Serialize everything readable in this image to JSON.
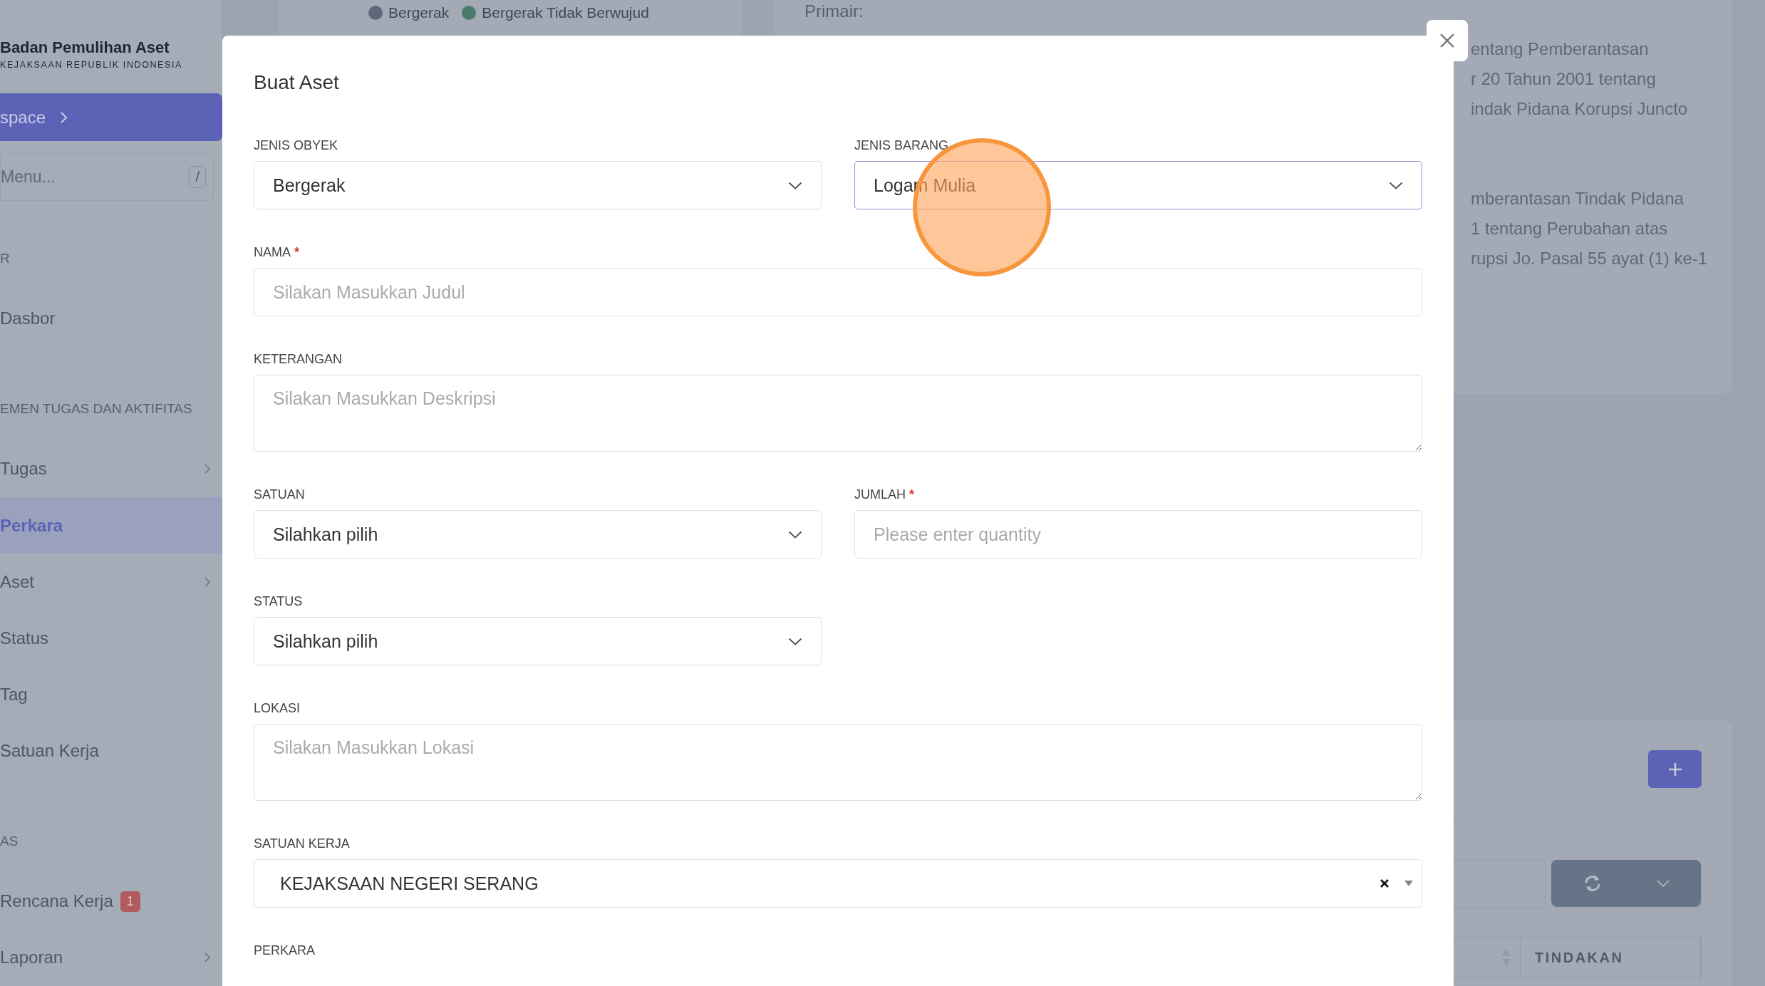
{
  "sidebar": {
    "brand_title": "Badan Pemulihan Aset",
    "brand_subtitle": "KEJAKSAAN REPUBLIK INDONESIA",
    "workspace_button": "space",
    "search": {
      "placeholder": "Menu...",
      "shortcut": "/"
    },
    "items": [
      {
        "kind": "section",
        "label": "R"
      },
      {
        "kind": "link",
        "label": "Dasbor",
        "chevron": false,
        "selected": false
      },
      {
        "kind": "section",
        "label": "EMEN TUGAS DAN AKTIFITAS"
      },
      {
        "kind": "link",
        "label": "Tugas",
        "chevron": true,
        "selected": false
      },
      {
        "kind": "link",
        "label": "Perkara",
        "chevron": false,
        "selected": true
      },
      {
        "kind": "link",
        "label": "Aset",
        "chevron": true,
        "selected": false
      },
      {
        "kind": "link",
        "label": "Status",
        "chevron": false,
        "selected": false
      },
      {
        "kind": "link",
        "label": "Tag",
        "chevron": false,
        "selected": false
      },
      {
        "kind": "link",
        "label": "Satuan Kerja",
        "chevron": false,
        "selected": false
      },
      {
        "kind": "section",
        "label": "AS"
      },
      {
        "kind": "link",
        "label": "Rencana Kerja",
        "chevron": false,
        "selected": false,
        "badge": "1"
      },
      {
        "kind": "link",
        "label": "Laporan",
        "chevron": true,
        "selected": false
      }
    ]
  },
  "background": {
    "chart_legend": [
      {
        "label": "Bergerak",
        "color": "#5f6878"
      },
      {
        "label": "Bergerak Tidak Berwujud",
        "color": "#4a7a68"
      }
    ],
    "detail_label": "Primair:",
    "detail_paragraphs": [
      [
        "entang Pemberantasan",
        "r 20 Tahun 2001 tentang",
        "indak Pidana Korupsi Juncto"
      ],
      [
        "mberantasan Tindak Pidana",
        "1 tentang Perubahan atas",
        "rupsi Jo. Pasal 55 ayat (1) ke-1"
      ]
    ],
    "table": {
      "columns": [
        "TINDAKAN"
      ]
    }
  },
  "modal": {
    "title": "Buat Aset",
    "rows": [
      [
        {
          "label": "JENIS OBYEK",
          "kind": "select",
          "value": "Bergerak",
          "focused": false
        },
        {
          "label": "JENIS BARANG",
          "kind": "select",
          "value": "Logam Mulia",
          "focused": true
        }
      ],
      [
        {
          "label": "NAMA",
          "required_mark": "*",
          "kind": "input",
          "placeholder": "Silakan Masukkan Judul"
        }
      ],
      [
        {
          "label": "KETERANGAN",
          "kind": "textarea",
          "placeholder": "Silakan Masukkan Deskripsi"
        }
      ],
      [
        {
          "label": "SATUAN",
          "kind": "select",
          "value": "Silahkan pilih",
          "focused": false
        },
        {
          "label": "JUMLAH",
          "required_mark": "*",
          "kind": "input",
          "placeholder": "Please enter quantity"
        }
      ],
      [
        {
          "label": "STATUS",
          "kind": "select",
          "value": "Silahkan pilih",
          "focused": false
        }
      ],
      [
        {
          "label": "LOKASI",
          "kind": "textarea",
          "placeholder": "Silakan Masukkan Lokasi"
        }
      ],
      [
        {
          "label": "SATUAN KERJA",
          "kind": "combo",
          "value": "KEJAKSAAN NEGERI SERANG"
        }
      ],
      [
        {
          "label": "PERKARA",
          "kind": "label"
        }
      ]
    ]
  }
}
